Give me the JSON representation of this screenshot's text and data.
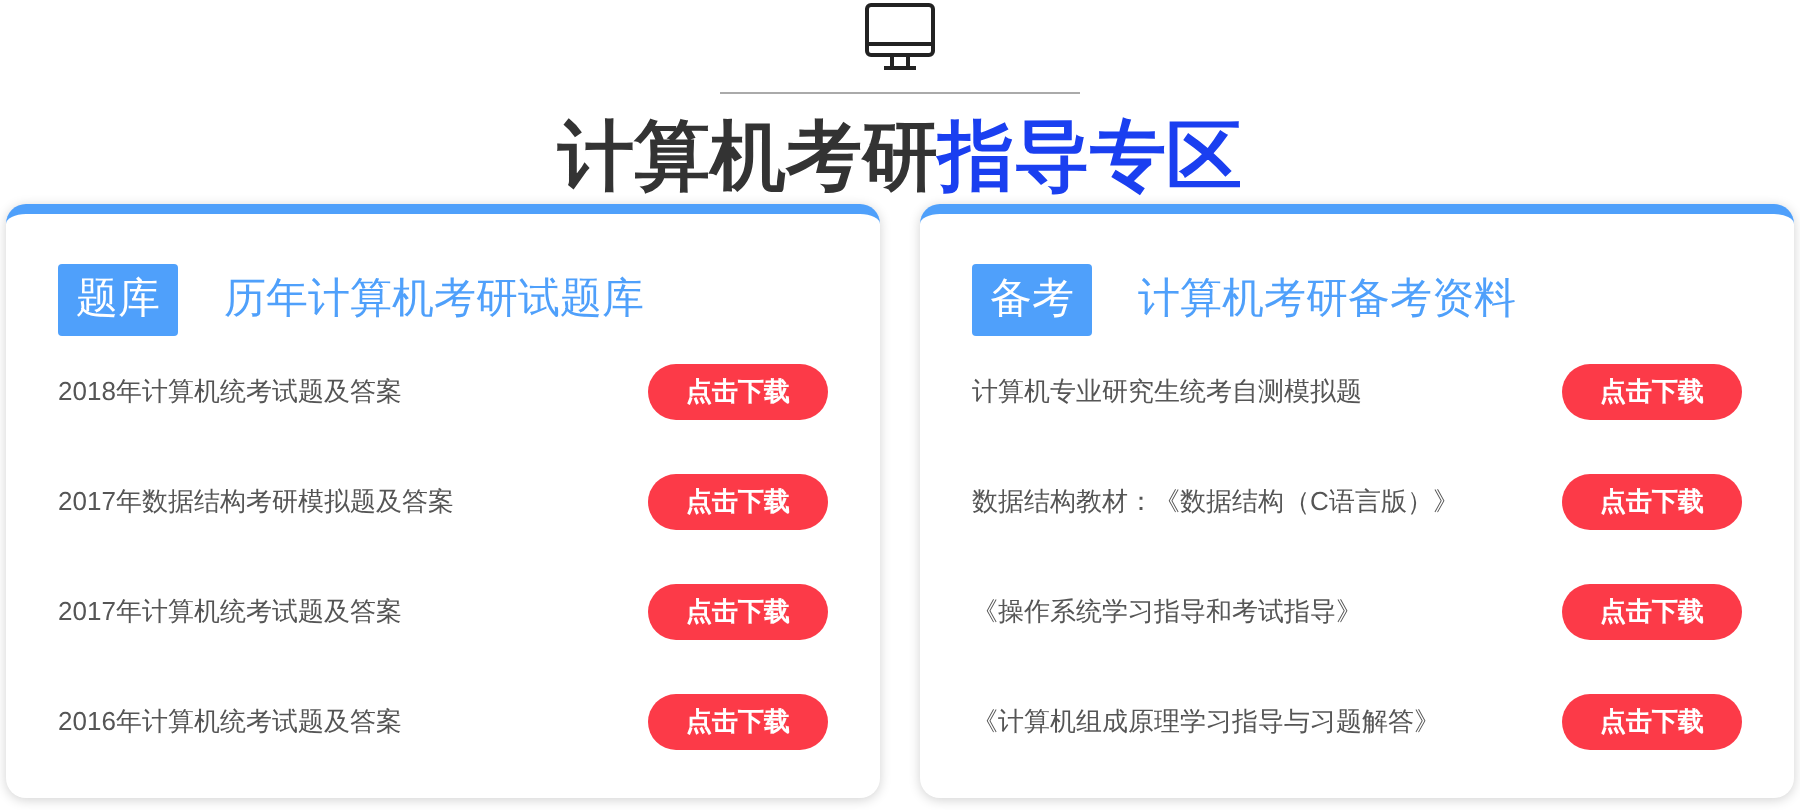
{
  "header": {
    "title_plain": "计算机考研",
    "title_accent": "指导专区"
  },
  "cards": [
    {
      "tag": "题库",
      "title": "历年计算机考研试题库",
      "items": [
        {
          "label": "2018年计算机统考试题及答案",
          "button": "点击下载"
        },
        {
          "label": "2017年数据结构考研模拟题及答案",
          "button": "点击下载"
        },
        {
          "label": "2017年计算机统考试题及答案",
          "button": "点击下载"
        },
        {
          "label": "2016年计算机统考试题及答案",
          "button": "点击下载"
        }
      ]
    },
    {
      "tag": "备考",
      "title": "计算机考研备考资料",
      "items": [
        {
          "label": "计算机专业研究生统考自测模拟题",
          "button": "点击下载"
        },
        {
          "label": "数据结构教材：《数据结构（C语言版）》",
          "button": "点击下载"
        },
        {
          "label": "《操作系统学习指导和考试指导》",
          "button": "点击下载"
        },
        {
          "label": "《计算机组成原理学习指导与习题解答》",
          "button": "点击下载"
        }
      ]
    }
  ]
}
